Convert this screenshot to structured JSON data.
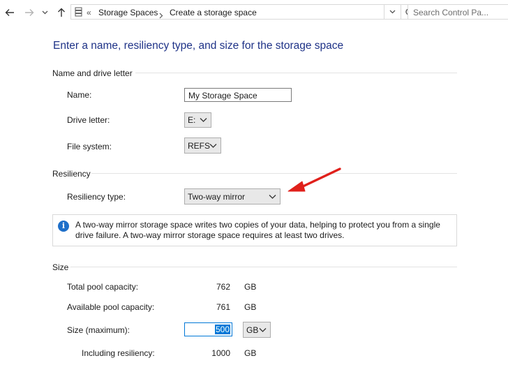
{
  "nav": {
    "back_icon": "back-arrow-icon",
    "forward_icon": "forward-arrow-icon",
    "recent_icon": "chevron-down-icon",
    "up_icon": "up-arrow-icon",
    "breadcrumb_overflow": "«",
    "breadcrumbs": [
      "Storage Spaces",
      "Create a storage space"
    ],
    "search_placeholder": "Search Control Pa..."
  },
  "page": {
    "heading": "Enter a name, resiliency type, and size for the storage space"
  },
  "name_section": {
    "title": "Name and drive letter",
    "name_label": "Name:",
    "name_value": "My Storage Space",
    "drive_letter_label": "Drive letter:",
    "drive_letter_value": "E:",
    "file_system_label": "File system:",
    "file_system_value": "REFS"
  },
  "resiliency_section": {
    "title": "Resiliency",
    "type_label": "Resiliency type:",
    "type_value": "Two-way mirror",
    "info_text": "A two-way mirror storage space writes two copies of your data, helping to protect you from a single drive failure. A two-way mirror storage space requires at least two drives."
  },
  "size_section": {
    "title": "Size",
    "total_label": "Total pool capacity:",
    "total_value": "762",
    "total_unit": "GB",
    "available_label": "Available pool capacity:",
    "available_value": "761",
    "available_unit": "GB",
    "size_label": "Size (maximum):",
    "size_value": "500",
    "size_unit": "GB",
    "including_label": "Including resiliency:",
    "including_value": "1000",
    "including_unit": "GB"
  },
  "colors": {
    "heading": "#1e3287",
    "annotation_arrow": "#e0201b",
    "selection": "#0078d7",
    "info_icon": "#1e6fc9"
  }
}
